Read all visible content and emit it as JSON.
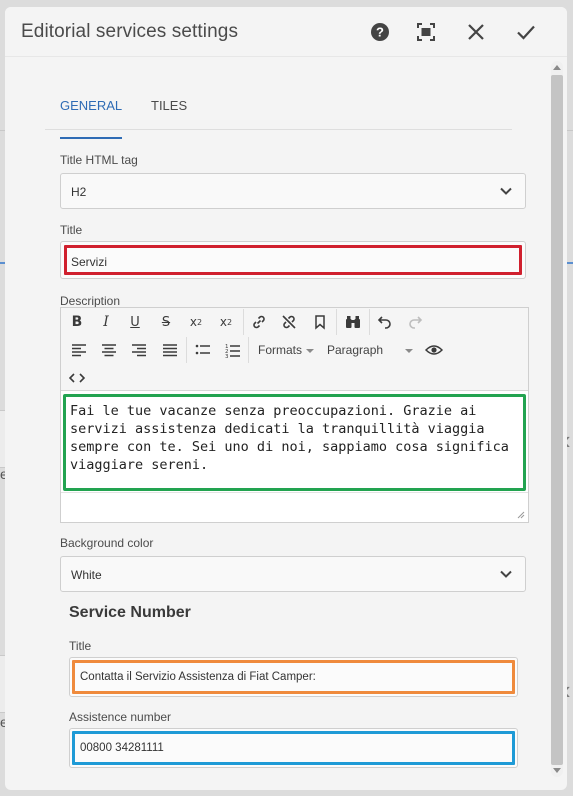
{
  "dialog": {
    "title": "Editorial services settings",
    "actions": {
      "help": "help-icon",
      "fullscreen": "fullscreen-icon",
      "close": "close-icon",
      "confirm": "check-icon"
    }
  },
  "tabs": [
    {
      "label": "GENERAL",
      "active": true
    },
    {
      "label": "TILES",
      "active": false
    }
  ],
  "fields": {
    "title_tag": {
      "label": "Title HTML tag",
      "value": "H2"
    },
    "title": {
      "label": "Title",
      "value": "Servizi"
    },
    "description": {
      "label": "Description",
      "text": "Fai le tue vacanze senza preoccupazioni. Grazie ai servizi assistenza dedicati la tranquillità viaggia sempre con te. Sei uno di noi, sappiamo cosa significa viaggiare sereni."
    },
    "background_color": {
      "label": "Background color",
      "value": "White"
    }
  },
  "toolbar": {
    "formats_label": "Formats",
    "paragraph_label": "Paragraph"
  },
  "service_number": {
    "heading": "Service Number",
    "title_label": "Title",
    "title_value": "Contatta il Servizio Assistenza di Fiat Camper:",
    "number_label": "Assistence number",
    "number_value": "00800 34281111"
  },
  "colors": {
    "accent_blue": "#2f6cb5",
    "highlight_red": "#d0202e",
    "highlight_green": "#22a350",
    "highlight_orange": "#ef8a3c",
    "highlight_cyan": "#1e9ad6"
  }
}
